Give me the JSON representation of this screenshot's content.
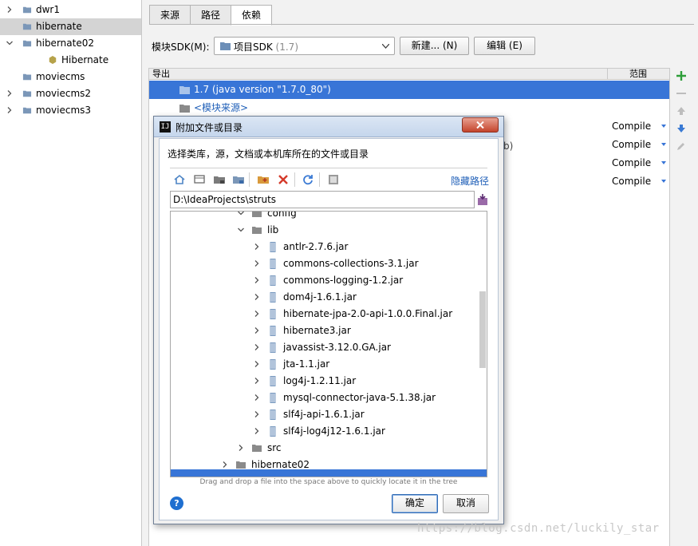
{
  "left_tree": {
    "items": [
      {
        "label": "dwr1",
        "expandable": true,
        "expanded": false,
        "selected": false
      },
      {
        "label": "hibernate",
        "expandable": false,
        "expanded": false,
        "selected": true
      },
      {
        "label": "hibernate02",
        "expandable": true,
        "expanded": true,
        "selected": false
      },
      {
        "label": "Hibernate",
        "expandable": false,
        "expanded": false,
        "selected": false,
        "child": true
      },
      {
        "label": "moviecms",
        "expandable": false,
        "expanded": false,
        "selected": false
      },
      {
        "label": "moviecms2",
        "expandable": true,
        "expanded": false,
        "selected": false
      },
      {
        "label": "moviecms3",
        "expandable": true,
        "expanded": false,
        "selected": false
      }
    ]
  },
  "tabs": [
    {
      "label": "来源",
      "active": false
    },
    {
      "label": "路径",
      "active": false
    },
    {
      "label": "依赖",
      "active": true
    }
  ],
  "sdk": {
    "label": "模块SDK(M):",
    "selected_main": "项目SDK",
    "selected_version": " (1.7)",
    "new_button": "新建... (N)",
    "edit_button": "编辑 (E)"
  },
  "dependencies": {
    "header_export": "导出",
    "header_scope": "范围",
    "rows": [
      {
        "label": "1.7 (java version \"1.7.0_80\")",
        "selected": true
      },
      {
        "label": "<模块来源>",
        "selected": false,
        "link": true
      }
    ],
    "scopes": [
      "Compile",
      "Compile",
      "Compile",
      "Compile"
    ],
    "partial_text": "b)"
  },
  "dialog": {
    "title": "附加文件或目录",
    "app_icon_text": "IJ",
    "description": "选择类库，源，文档或本机库所在的文件或目录",
    "hide_path": "隐藏路径",
    "path_value": "D:\\IdeaProjects\\struts",
    "tree": [
      {
        "label": "config",
        "type": "folder",
        "depth": 4,
        "chevron": "down"
      },
      {
        "label": "lib",
        "type": "folder",
        "depth": 4,
        "chevron": "down"
      },
      {
        "label": "antlr-2.7.6.jar",
        "type": "jar",
        "depth": 5,
        "chevron": "right"
      },
      {
        "label": "commons-collections-3.1.jar",
        "type": "jar",
        "depth": 5,
        "chevron": "right"
      },
      {
        "label": "commons-logging-1.2.jar",
        "type": "jar",
        "depth": 5,
        "chevron": "right"
      },
      {
        "label": "dom4j-1.6.1.jar",
        "type": "jar",
        "depth": 5,
        "chevron": "right"
      },
      {
        "label": "hibernate-jpa-2.0-api-1.0.0.Final.jar",
        "type": "jar",
        "depth": 5,
        "chevron": "right"
      },
      {
        "label": "hibernate3.jar",
        "type": "jar",
        "depth": 5,
        "chevron": "right"
      },
      {
        "label": "javassist-3.12.0.GA.jar",
        "type": "jar",
        "depth": 5,
        "chevron": "right"
      },
      {
        "label": "jta-1.1.jar",
        "type": "jar",
        "depth": 5,
        "chevron": "right"
      },
      {
        "label": "log4j-1.2.11.jar",
        "type": "jar",
        "depth": 5,
        "chevron": "right"
      },
      {
        "label": "mysql-connector-java-5.1.38.jar",
        "type": "jar",
        "depth": 5,
        "chevron": "right"
      },
      {
        "label": "slf4j-api-1.6.1.jar",
        "type": "jar",
        "depth": 5,
        "chevron": "right"
      },
      {
        "label": "slf4j-log4j12-1.6.1.jar",
        "type": "jar",
        "depth": 5,
        "chevron": "right"
      },
      {
        "label": "src",
        "type": "folder",
        "depth": 4,
        "chevron": "right"
      },
      {
        "label": "hibernate02",
        "type": "folder",
        "depth": 3,
        "chevron": "right"
      }
    ],
    "drag_hint": "Drag and drop a file into the space above to quickly locate it in the tree",
    "help_label": "?",
    "ok_button": "确定",
    "cancel_button": "取消"
  },
  "watermark": "https://blog.csdn.net/luckily_star",
  "colors": {
    "selection": "#3875d7",
    "link": "#1f5fb8",
    "add_icon": "#2e9e3a",
    "dialog_close": "#c4442c"
  }
}
